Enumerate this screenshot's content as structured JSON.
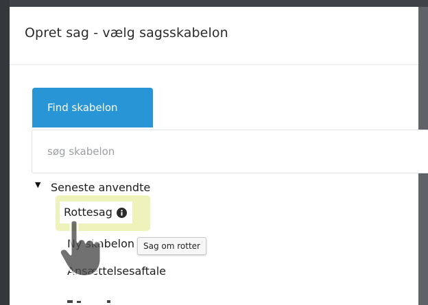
{
  "dialog": {
    "title": "Opret sag - vælg sagsskabelon"
  },
  "tabs": [
    {
      "label": "Find skabelon",
      "active": true
    }
  ],
  "search": {
    "placeholder": "søg skabelon",
    "value": ""
  },
  "tree": {
    "toggle_glyph": "▼",
    "group_label": "Seneste anvendte",
    "items": [
      {
        "label": "Rottesag",
        "icon": "info-icon",
        "highlighted": true
      },
      {
        "label": "Ny skabelon"
      },
      {
        "label": "Ansættelsesaftale"
      }
    ]
  },
  "tooltip": {
    "text": "Sag om rotter"
  },
  "colors": {
    "accent": "#2896d6",
    "highlight": "#edf3ba",
    "backdrop": "#5f6266"
  }
}
